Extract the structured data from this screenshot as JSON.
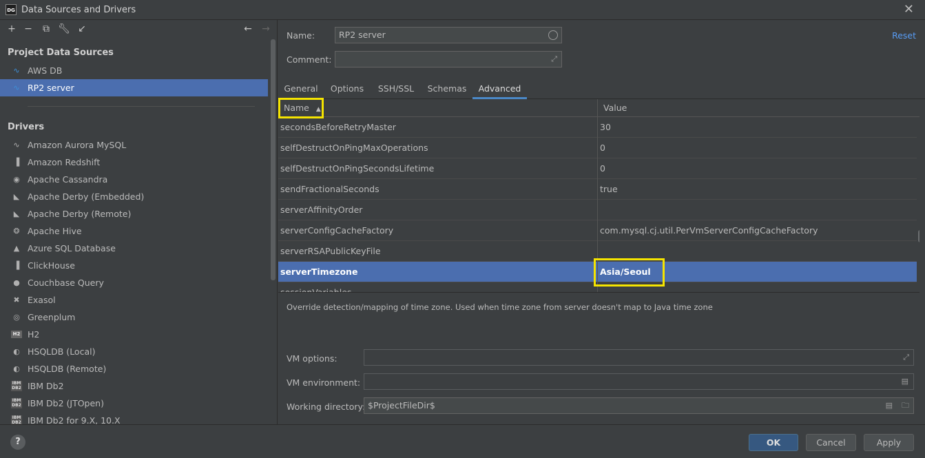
{
  "window": {
    "title": "Data Sources and Drivers",
    "logo": "DG"
  },
  "left": {
    "project_header": "Project Data Sources",
    "project_sources": [
      {
        "label": "AWS DB",
        "icon": "mysql-icon"
      },
      {
        "label": "RP2 server",
        "icon": "mysql-icon",
        "selected": true
      }
    ],
    "drivers_header": "Drivers",
    "drivers": [
      {
        "label": "Amazon Aurora MySQL",
        "glyph": "∿"
      },
      {
        "label": "Amazon Redshift",
        "glyph": "▐"
      },
      {
        "label": "Apache Cassandra",
        "glyph": "◉"
      },
      {
        "label": "Apache Derby (Embedded)",
        "glyph": "◣"
      },
      {
        "label": "Apache Derby (Remote)",
        "glyph": "◣"
      },
      {
        "label": "Apache Hive",
        "glyph": "❂"
      },
      {
        "label": "Azure SQL Database",
        "glyph": "▲"
      },
      {
        "label": "ClickHouse",
        "glyph": "▐"
      },
      {
        "label": "Couchbase Query",
        "glyph": "●"
      },
      {
        "label": "Exasol",
        "glyph": "✖"
      },
      {
        "label": "Greenplum",
        "glyph": "◎"
      },
      {
        "label": "H2",
        "glyph": "H2"
      },
      {
        "label": "HSQLDB (Local)",
        "glyph": "◐"
      },
      {
        "label": "HSQLDB (Remote)",
        "glyph": "◐"
      },
      {
        "label": "IBM Db2",
        "glyph": "IBM DB2"
      },
      {
        "label": "IBM Db2 (JTOpen)",
        "glyph": "IBM DB2"
      },
      {
        "label": "IBM Db2 for 9.X, 10.X",
        "glyph": "IBM DB2"
      }
    ]
  },
  "form": {
    "name_label": "Name:",
    "name_value": "RP2 server",
    "comment_label": "Comment:",
    "comment_value": "",
    "reset": "Reset"
  },
  "tabs": [
    "General",
    "Options",
    "SSH/SSL",
    "Schemas",
    "Advanced"
  ],
  "active_tab": "Advanced",
  "table": {
    "col_name": "Name",
    "col_value": "Value",
    "rows": [
      {
        "name": "secondsBeforeRetryMaster",
        "value": "30"
      },
      {
        "name": "selfDestructOnPingMaxOperations",
        "value": "0"
      },
      {
        "name": "selfDestructOnPingSecondsLifetime",
        "value": "0"
      },
      {
        "name": "sendFractionalSeconds",
        "value": "true"
      },
      {
        "name": "serverAffinityOrder",
        "value": ""
      },
      {
        "name": "serverConfigCacheFactory",
        "value": "com.mysql.cj.util.PerVmServerConfigCacheFactory"
      },
      {
        "name": "serverRSAPublicKeyFile",
        "value": ""
      },
      {
        "name": "serverTimezone",
        "value": "Asia/Seoul",
        "selected": true
      },
      {
        "name": "sessionVariables",
        "value": ""
      }
    ]
  },
  "description": "Override detection/mapping of time zone. Used when time zone from server doesn't map to Java time zone",
  "vm": {
    "options_label": "VM options:",
    "options_value": "",
    "env_label": "VM environment:",
    "env_value": "",
    "workdir_label": "Working directory:",
    "workdir_value": "$ProjectFileDir$"
  },
  "buttons": {
    "ok": "OK",
    "cancel": "Cancel",
    "apply": "Apply",
    "help": "?"
  },
  "colors": {
    "selection": "#4b6eaf",
    "highlight": "#f5e400",
    "link": "#589df6",
    "background": "#3c3f41"
  }
}
